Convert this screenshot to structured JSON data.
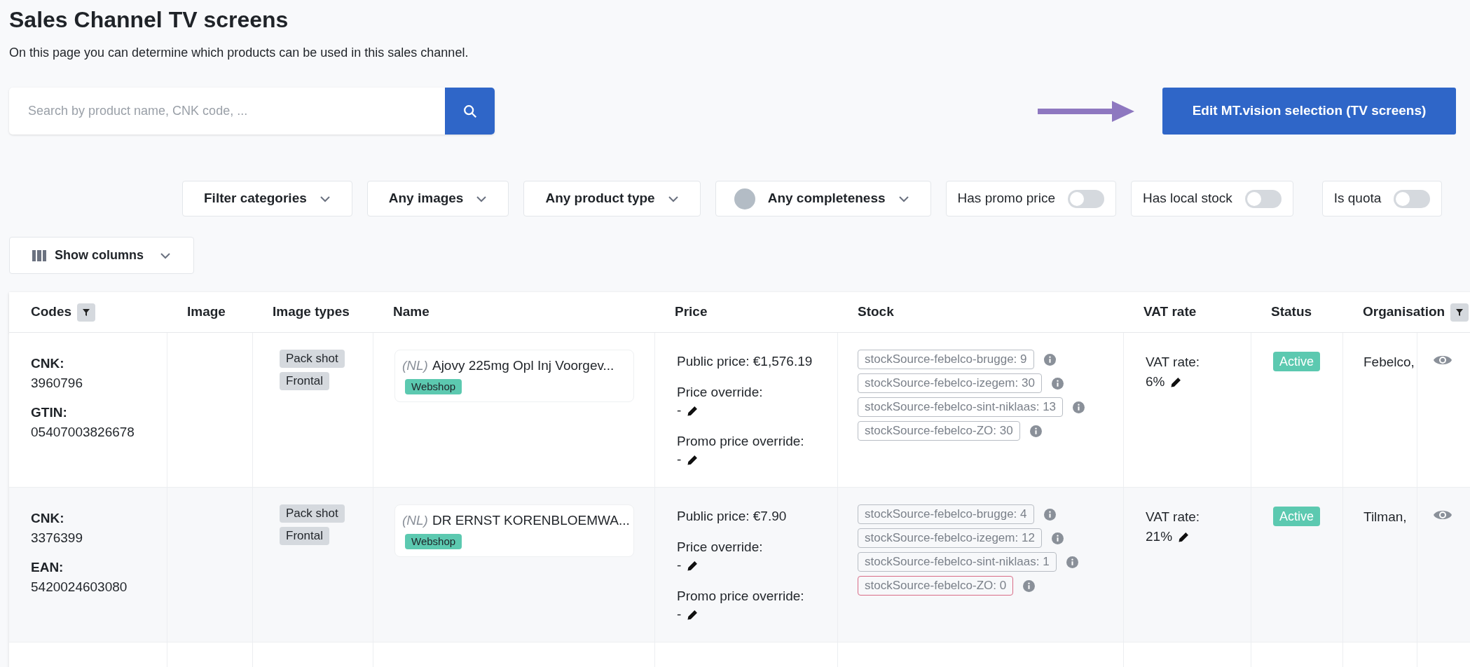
{
  "page": {
    "title": "Sales Channel TV screens",
    "subtitle": "On this page you can determine which products can be used in this sales channel."
  },
  "search": {
    "placeholder": "Search by product name, CNK code, ..."
  },
  "edit_button": "Edit MT.vision selection (TV screens)",
  "filters": [
    {
      "kind": "dropdown",
      "label": "Filter categories",
      "dot": false
    },
    {
      "kind": "dropdown",
      "label": "Any images",
      "dot": false
    },
    {
      "kind": "dropdown",
      "label": "Any product type",
      "dot": false
    },
    {
      "kind": "dropdown",
      "label": "Any completeness",
      "dot": true
    },
    {
      "kind": "toggle",
      "label": "Has promo price",
      "on": false
    },
    {
      "kind": "toggle",
      "label": "Has local stock",
      "on": false
    },
    {
      "kind": "toggle",
      "label": "Is quota",
      "on": false
    }
  ],
  "show_columns": "Show columns",
  "table": {
    "columns": [
      {
        "label": "Codes",
        "filter": true
      },
      {
        "label": "Image",
        "filter": false
      },
      {
        "label": "Image types",
        "filter": false
      },
      {
        "label": "Name",
        "filter": false
      },
      {
        "label": "Price",
        "filter": false
      },
      {
        "label": "Stock",
        "filter": false
      },
      {
        "label": "VAT rate",
        "filter": false
      },
      {
        "label": "Status",
        "filter": false
      },
      {
        "label": "Organisation",
        "filter": true
      }
    ],
    "rows": [
      {
        "codes": [
          {
            "label": "CNK:",
            "value": "3960796"
          },
          {
            "label": "GTIN:",
            "value": "05407003826678"
          }
        ],
        "image_types": [
          "Pack shot",
          "Frontal"
        ],
        "lang": "(NL)",
        "name": "Ajovy 225mg Opl Inj Voorgev...",
        "channel": "Webshop",
        "public_price": "Public price: €1,576.19",
        "price_override_label": "Price override:",
        "price_override": "-",
        "promo_override_label": "Promo price override:",
        "promo_override": "-",
        "stock": [
          {
            "text": "stockSource-febelco-brugge: 9",
            "out_of_stock": false
          },
          {
            "text": "stockSource-febelco-izegem: 30",
            "out_of_stock": false
          },
          {
            "text": "stockSource-febelco-sint-niklaas: 13",
            "out_of_stock": false
          },
          {
            "text": "stockSource-febelco-ZO: 30",
            "out_of_stock": false
          }
        ],
        "vat_label": "VAT rate:",
        "vat": "6%",
        "status": "Active",
        "organisation": "Febelco,"
      },
      {
        "codes": [
          {
            "label": "CNK:",
            "value": "3376399"
          },
          {
            "label": "EAN:",
            "value": "5420024603080"
          }
        ],
        "image_types": [
          "Pack shot",
          "Frontal"
        ],
        "lang": "(NL)",
        "name": "DR ERNST KORENBLOEMWA...",
        "channel": "Webshop",
        "public_price": "Public price: €7.90",
        "price_override_label": "Price override:",
        "price_override": "-",
        "promo_override_label": "Promo price override:",
        "promo_override": "-",
        "stock": [
          {
            "text": "stockSource-febelco-brugge: 4",
            "out_of_stock": false
          },
          {
            "text": "stockSource-febelco-izegem: 12",
            "out_of_stock": false
          },
          {
            "text": "stockSource-febelco-sint-niklaas: 1",
            "out_of_stock": false
          },
          {
            "text": "stockSource-febelco-ZO: 0",
            "out_of_stock": true
          }
        ],
        "vat_label": "VAT rate:",
        "vat": "21%",
        "status": "Active",
        "organisation": "Tilman,"
      }
    ]
  }
}
